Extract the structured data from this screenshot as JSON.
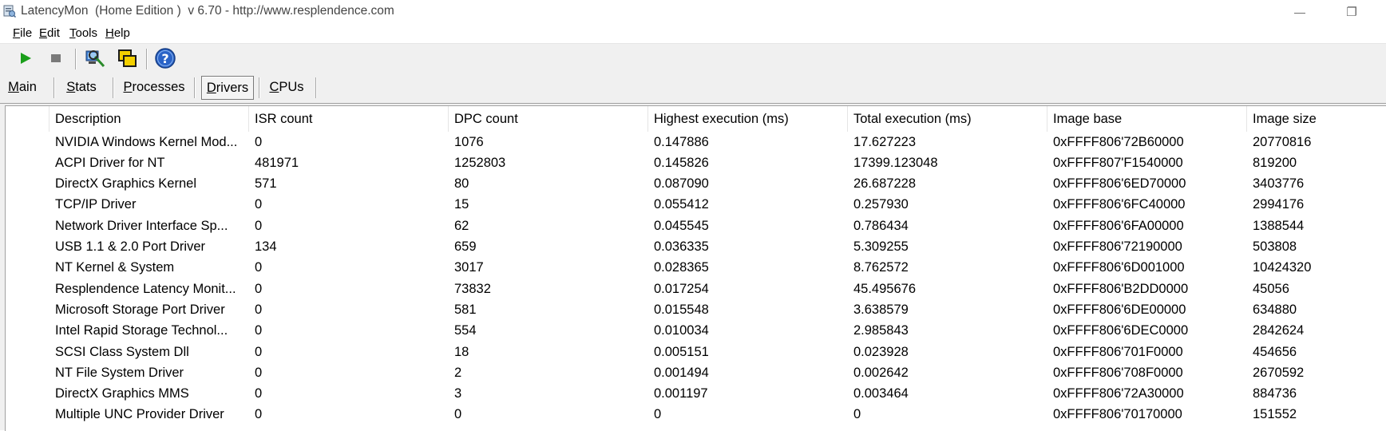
{
  "window": {
    "title": "LatencyMon  (Home Edition )  v 6.70 - http://www.resplendence.com",
    "minimize_glyph": "—",
    "restore_glyph": "❐"
  },
  "menu": {
    "items": [
      {
        "underline": "F",
        "rest": "ile"
      },
      {
        "underline": "E",
        "rest": "dit"
      },
      {
        "underline": "T",
        "rest": "ools"
      },
      {
        "underline": "H",
        "rest": "elp"
      }
    ]
  },
  "toolbar": {
    "icons": [
      "play-icon",
      "stop-icon",
      "analyze-icon",
      "windows-icon",
      "help-icon"
    ],
    "colors": {
      "play": "#1a9e1a",
      "stop": "#7a7a7a",
      "help": "#2a63c7"
    }
  },
  "tabs": {
    "items": [
      {
        "underline": "M",
        "rest": "ain"
      },
      {
        "underline": "S",
        "rest": "tats"
      },
      {
        "underline": "P",
        "rest": "rocesses"
      },
      {
        "underline": "D",
        "rest": "rivers"
      },
      {
        "underline": "C",
        "rest": "PUs"
      }
    ],
    "active_index": 3
  },
  "table": {
    "columns": [
      "Description",
      "ISR count",
      "DPC count",
      "Highest execution (ms)",
      "Total execution (ms)",
      "Image base",
      "Image size"
    ],
    "rows": [
      [
        "NVIDIA Windows Kernel Mod...",
        "0",
        "1076",
        "0.147886",
        "17.627223",
        "0xFFFF806'72B60000",
        "20770816"
      ],
      [
        "ACPI Driver for NT",
        "481971",
        "1252803",
        "0.145826",
        "17399.123048",
        "0xFFFF807'F1540000",
        "819200"
      ],
      [
        "DirectX Graphics Kernel",
        "571",
        "80",
        "0.087090",
        "26.687228",
        "0xFFFF806'6ED70000",
        "3403776"
      ],
      [
        "TCP/IP Driver",
        "0",
        "15",
        "0.055412",
        "0.257930",
        "0xFFFF806'6FC40000",
        "2994176"
      ],
      [
        "Network Driver Interface Sp...",
        "0",
        "62",
        "0.045545",
        "0.786434",
        "0xFFFF806'6FA00000",
        "1388544"
      ],
      [
        "USB 1.1 & 2.0 Port Driver",
        "134",
        "659",
        "0.036335",
        "5.309255",
        "0xFFFF806'72190000",
        "503808"
      ],
      [
        "NT Kernel & System",
        "0",
        "3017",
        "0.028365",
        "8.762572",
        "0xFFFF806'6D001000",
        "10424320"
      ],
      [
        "Resplendence Latency Monit...",
        "0",
        "73832",
        "0.017254",
        "45.495676",
        "0xFFFF806'B2DD0000",
        "45056"
      ],
      [
        "Microsoft Storage Port Driver",
        "0",
        "581",
        "0.015548",
        "3.638579",
        "0xFFFF806'6DE00000",
        "634880"
      ],
      [
        "Intel Rapid Storage Technol...",
        "0",
        "554",
        "0.010034",
        "2.985843",
        "0xFFFF806'6DEC0000",
        "2842624"
      ],
      [
        "SCSI Class System Dll",
        "0",
        "18",
        "0.005151",
        "0.023928",
        "0xFFFF806'701F0000",
        "454656"
      ],
      [
        "NT File System Driver",
        "0",
        "2",
        "0.001494",
        "0.002642",
        "0xFFFF806'708F0000",
        "2670592"
      ],
      [
        "DirectX Graphics MMS",
        "0",
        "3",
        "0.001197",
        "0.003464",
        "0xFFFF806'72A30000",
        "884736"
      ],
      [
        "Multiple UNC Provider Driver",
        "0",
        "0",
        "0",
        "0",
        "0xFFFF806'70170000",
        "151552"
      ]
    ]
  }
}
